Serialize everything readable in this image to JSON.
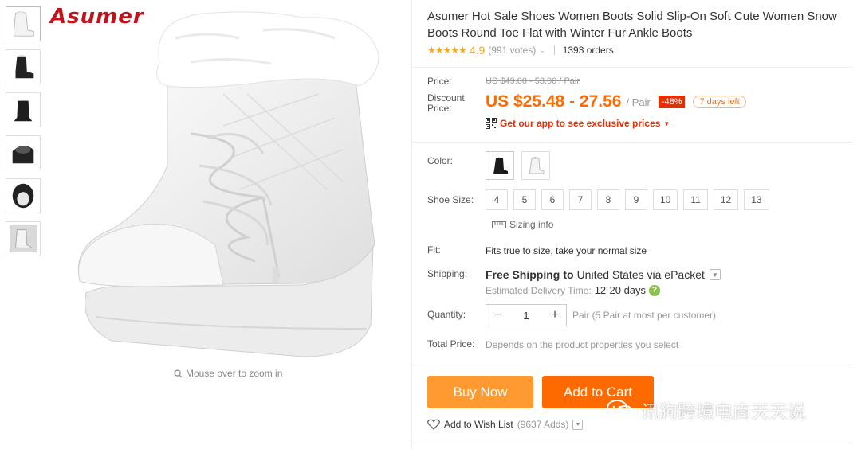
{
  "brand": {
    "name": "Asumer"
  },
  "gallery": {
    "zoom_hint": "Mouse over to zoom in",
    "thumbnails": [
      "boot-white-side",
      "boot-black-side",
      "boot-black-front",
      "boot-black-fur",
      "boot-black-top",
      "boot-white-sole"
    ]
  },
  "product": {
    "title": "Asumer Hot Sale Shoes Women Boots Solid Slip-On Soft Cute Women Snow Boots Round Toe Flat with Winter Fur Ankle Boots",
    "stars": "★★★★★",
    "rating": "4.9",
    "votes": "(991 votes)",
    "orders": "1393 orders"
  },
  "price": {
    "price_label": "Price:",
    "original": "US $49.00 - 53.00 / Pair",
    "discount_label_1": "Discount",
    "discount_label_2": "Price:",
    "discount": "US $25.48 - 27.56",
    "unit": "/ Pair",
    "off": "-48%",
    "days_left": "7 days left",
    "app_promo": "Get our app to see exclusive prices"
  },
  "options": {
    "color_label": "Color:",
    "size_label": "Shoe Size:",
    "sizes": [
      "4",
      "5",
      "6",
      "7",
      "8",
      "9",
      "10",
      "11",
      "12",
      "13"
    ],
    "sizing_info": "Sizing info",
    "fit_label": "Fit:",
    "fit_value": "Fits true to size, take your normal size",
    "shipping_label": "Shipping:",
    "free_shipping": "Free Shipping",
    "ship_to": "to",
    "ship_dest": "United States via ePacket",
    "delivery_label": "Estimated Delivery Time:",
    "delivery_days": "12-20 days",
    "quantity_label": "Quantity:",
    "quantity": "1",
    "quantity_note": "Pair (5 Pair at most per customer)",
    "total_label": "Total Price:",
    "total_value": "Depends on the product properties you select"
  },
  "actions": {
    "buy_now": "Buy Now",
    "add_to_cart": "Add to Cart",
    "wish_list": "Add to Wish List",
    "wish_adds": "(9637 Adds)"
  },
  "watermark": {
    "text": "讯狗跨境电商天天说"
  },
  "colors": {
    "accent": "#ff6a00",
    "buy": "#ff9a30",
    "badge": "#e62e04",
    "star": "#f5a623"
  }
}
